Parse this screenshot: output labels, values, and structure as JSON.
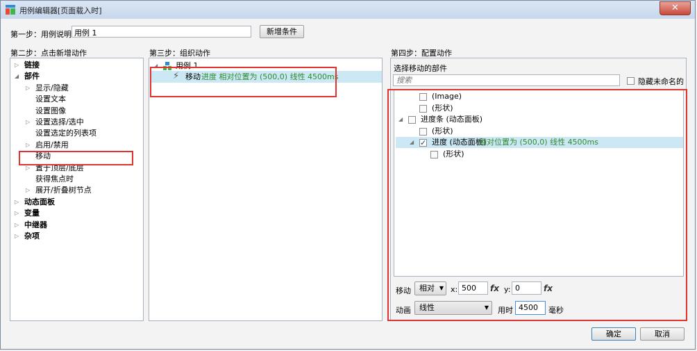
{
  "window": {
    "title": "用例编辑器[页面载入时]",
    "close_symbol": "✕"
  },
  "step1": {
    "label": "第一步：用例说明",
    "case_value": "用例 1",
    "add_condition_button": "新增条件"
  },
  "step2": {
    "label": "第二步：点击新增动作",
    "items": [
      {
        "label": "链接",
        "bold": true,
        "toggle": "collapsed"
      },
      {
        "label": "部件",
        "bold": true,
        "toggle": "expanded"
      },
      {
        "label": "显示/隐藏",
        "toggle": "collapsed"
      },
      {
        "label": "设置文本"
      },
      {
        "label": "设置图像"
      },
      {
        "label": "设置选择/选中",
        "toggle": "collapsed"
      },
      {
        "label": "设置选定的列表项"
      },
      {
        "label": "启用/禁用",
        "toggle": "collapsed"
      },
      {
        "label": "移动"
      },
      {
        "label": "置于顶层/底层",
        "toggle": "collapsed"
      },
      {
        "label": "获得焦点时"
      },
      {
        "label": "展开/折叠树节点",
        "toggle": "collapsed"
      },
      {
        "label": "动态面板",
        "bold": true,
        "toggle": "collapsed"
      },
      {
        "label": "变量",
        "bold": true,
        "toggle": "collapsed"
      },
      {
        "label": "中继器",
        "bold": true,
        "toggle": "collapsed"
      },
      {
        "label": "杂项",
        "bold": true,
        "toggle": "collapsed"
      }
    ]
  },
  "step3": {
    "label": "第三步：组织动作",
    "case_name": "用例 1",
    "action_prefix": "移动",
    "action_detail": "进度 相对位置为 (500,0) 线性 4500ms"
  },
  "step4": {
    "label": "第四步：配置动作",
    "select_widget_label": "选择移动的部件",
    "search_placeholder": "搜索",
    "hide_unnamed_label": "隐藏未命名的",
    "widgets": [
      {
        "label": "(Image)",
        "checked": false
      },
      {
        "label": "(形状)",
        "checked": false
      },
      {
        "label": "进度条 (动态面板)",
        "checked": false,
        "toggle": "expanded"
      },
      {
        "label": "(形状)",
        "checked": false
      },
      {
        "label": "进度 (动态面板)",
        "detail": "相对位置为 (500,0) 线性 4500ms",
        "checked": true,
        "toggle": "expanded",
        "selected": true
      },
      {
        "label": "(形状)",
        "checked": false
      }
    ],
    "move_label": "移动",
    "move_type": "相对",
    "x_label": "x:",
    "x_value": "500",
    "y_label": "y:",
    "y_value": "0",
    "fx_label": "fx",
    "animation_label": "动画",
    "animation_value": "线性",
    "duration_label": "用时",
    "duration_value": "4500",
    "duration_unit": "毫秒"
  },
  "footer": {
    "ok_button": "确定",
    "cancel_button": "取消"
  },
  "colors": {
    "highlight_red": "#e0322e",
    "selection_blue": "#cde8f5",
    "detail_green": "#2f8a2f"
  }
}
